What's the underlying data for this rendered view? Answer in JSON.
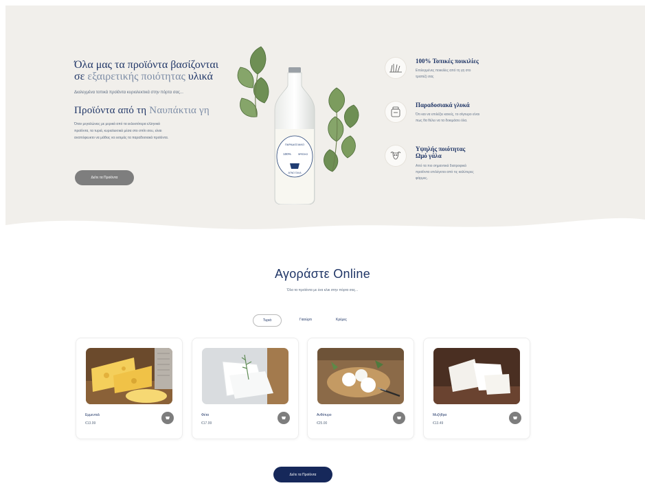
{
  "hero": {
    "title_part1": "Όλα μας τα προϊόντα βασίζονται σε",
    "title_part2": "εξαιρετικής ποιότητας",
    "title_part3": "υλικά",
    "subtitle": "Διαλεγμένα τοπικά προϊόντα κυριολεκτικά στην πόρτα σας...",
    "title2_part1": "Προϊόντα από τη",
    "title2_part2": "Ναυπάκτια γη",
    "text_line1": "Όταν μεγαλώνεις με μερικά από τα εκλεκτότερα ελληνικά",
    "text_line2": "προϊόντα, τα τυριά, κυριολεκτικά μέσα στο σπίτι σου, είναι",
    "text_line3": "αναπόφευκτο να μάθεις να εκτιμάς τα παραδοσιακά προϊόντα.",
    "button_label": "Δείτε τα Προϊόντα"
  },
  "features": [
    {
      "icon": "grass-icon",
      "title": "100% Τοπικές ποικιλίες",
      "text_line1": "Επιλεγμένες ποικιλίες από τη γη στο",
      "text_line2": "τραπέζι σας"
    },
    {
      "icon": "jar-icon",
      "title": "Παραδοσιακά γλυκά",
      "text_line1": "Ότι και να επιλέξει κανείς, το σίγουρο είναι",
      "text_line2": "πως θα θέλει να τα δοκιμάσει όλα."
    },
    {
      "icon": "cow-icon",
      "title_line1": "Υψηλής ποιότητας",
      "title_line2": "Ωμό γάλα",
      "text_line1": "Από τα πιο σημαντικά διατροφικά",
      "text_line2": "προϊόντα επιλέγεται από τις καλύτερες",
      "text_line3": "φάρμες."
    }
  ],
  "bottle_label": {
    "line1": "ΠΑΡΑΔΟΣΙΑΚΟ",
    "line2": "100%",
    "line3": "ΦΡΕΣΚΟ",
    "line4": "ΑΓΝΟ ΓΑΛΑ"
  },
  "shop": {
    "title": "Αγοράστε Online",
    "subtitle": "Όλα τα προϊόντα με ένα κλικ στην πόρτα σας...",
    "tabs": [
      "Τυριά",
      "Γιαούρτι",
      "Κρέμες"
    ],
    "products": [
      {
        "name": "Εμμενταλ",
        "price": "€13.99"
      },
      {
        "name": "Φέτα",
        "price": "€17.99"
      },
      {
        "name": "Ανθότυρο",
        "price": "€25.00"
      },
      {
        "name": "Μυζήθρα",
        "price": "€13.49"
      }
    ],
    "all_button": "Δείτε τα Προϊόντα"
  },
  "colors": {
    "primary": "#1f3566",
    "hero_bg": "#f1efeb",
    "dark_button": "#16285a",
    "grey_button": "#7e7e7e"
  }
}
